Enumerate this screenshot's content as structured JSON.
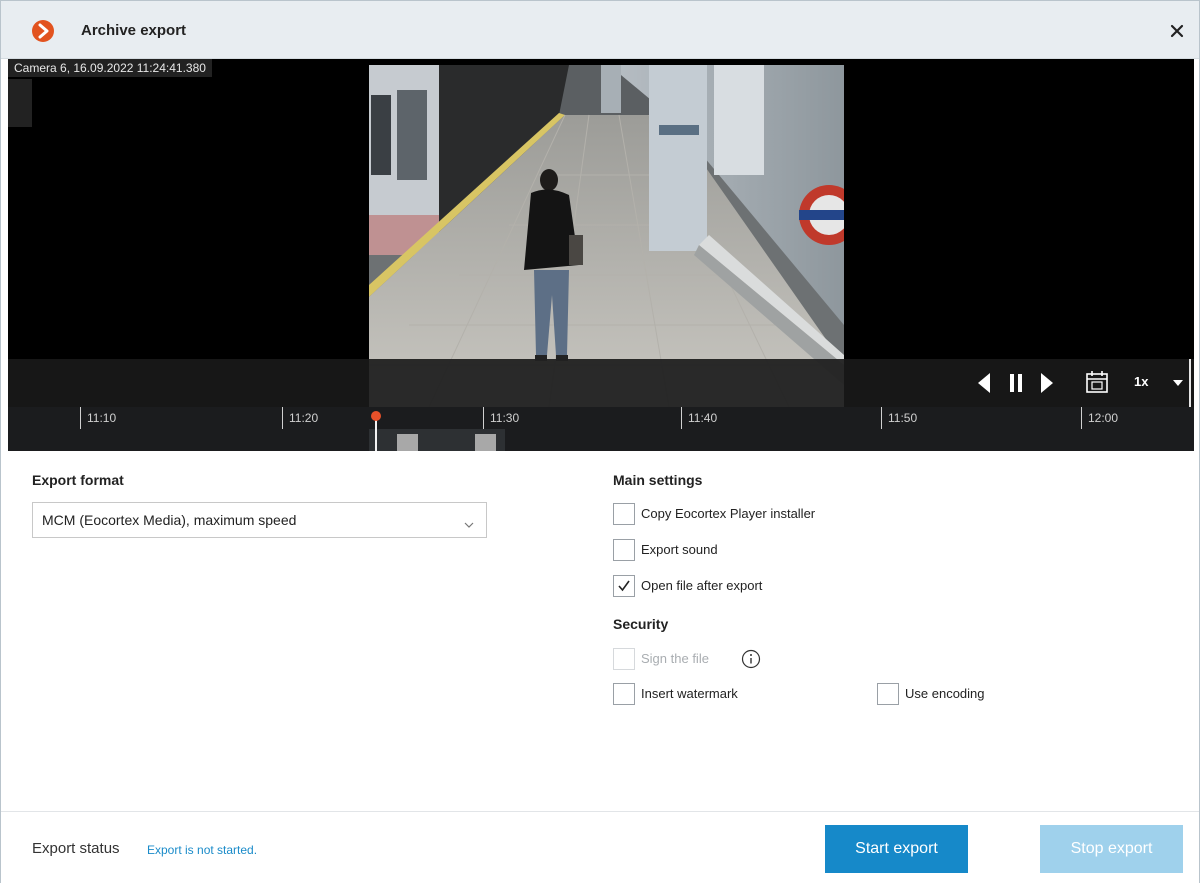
{
  "window": {
    "title": "Archive export",
    "close_icon": "close-icon",
    "logo_icon": "app-logo-icon",
    "accent_color": "#e2531f"
  },
  "player": {
    "camera_label": "Camera 6, 16.09.2022 11:24:41.380",
    "speed": "1x",
    "icons": [
      "step-back-icon",
      "pause-icon",
      "step-forward-icon",
      "calendar-icon",
      "chevron-down-icon"
    ]
  },
  "timeline": {
    "ticks": [
      "11:10",
      "11:20",
      "11:30",
      "11:40",
      "11:50",
      "12:00"
    ],
    "cursor_color": "#e8512a"
  },
  "export_format": {
    "heading": "Export format",
    "selected": "MCM (Eocortex Media), maximum speed"
  },
  "main_settings": {
    "heading": "Main settings",
    "options": [
      {
        "label": "Copy Eocortex Player installer",
        "checked": false
      },
      {
        "label": "Export sound",
        "checked": false
      },
      {
        "label": "Open file after export",
        "checked": true
      }
    ]
  },
  "security": {
    "heading": "Security",
    "sign_file": {
      "label": "Sign the file",
      "checked": false,
      "disabled": true
    },
    "insert_watermark": {
      "label": "Insert watermark",
      "checked": false
    },
    "use_encoding": {
      "label": "Use encoding",
      "checked": false
    }
  },
  "footer": {
    "status_label": "Export status",
    "status_value": "Export is not started.",
    "start_button": "Start export",
    "stop_button": "Stop export",
    "primary_color": "#1689c9",
    "disabled_color": "#9fd1ec"
  }
}
